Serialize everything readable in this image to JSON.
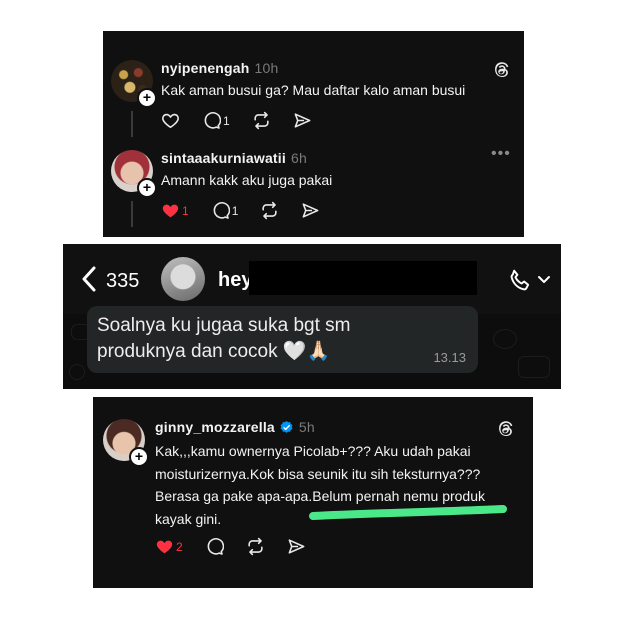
{
  "thread1": {
    "comment1": {
      "username": "nyipenengah",
      "time": "10h",
      "text": "Kak aman busui ga? Mau daftar kalo aman busui",
      "reply_count": "1"
    },
    "comment2": {
      "username": "sintaaakurniawatii",
      "time": "6h",
      "text": "Amann kakk aku juga pakai",
      "like_count": "1",
      "reply_count": "1"
    }
  },
  "whatsapp": {
    "back_count": "335",
    "contact_name": "hey",
    "message": "Soalnya ku jugaa suka bgt sm produknya dan cocok 🤍🙏🏻",
    "time": "13.13"
  },
  "thread2": {
    "username": "ginny_mozzarella",
    "time": "5h",
    "text": "Kak,,,kamu ownernya Picolab+??? Aku udah pakai moisturizernya.Kok bisa seunik itu sih teksturnya??? Berasa ga pake apa-apa.Belum pernah nemu produk kayak gini.",
    "like_count": "2"
  },
  "colors": {
    "panel_bg": "#101010",
    "heart_red": "#ff3040",
    "verified_blue": "#0095f6",
    "highlight_green": "#4be88a"
  }
}
